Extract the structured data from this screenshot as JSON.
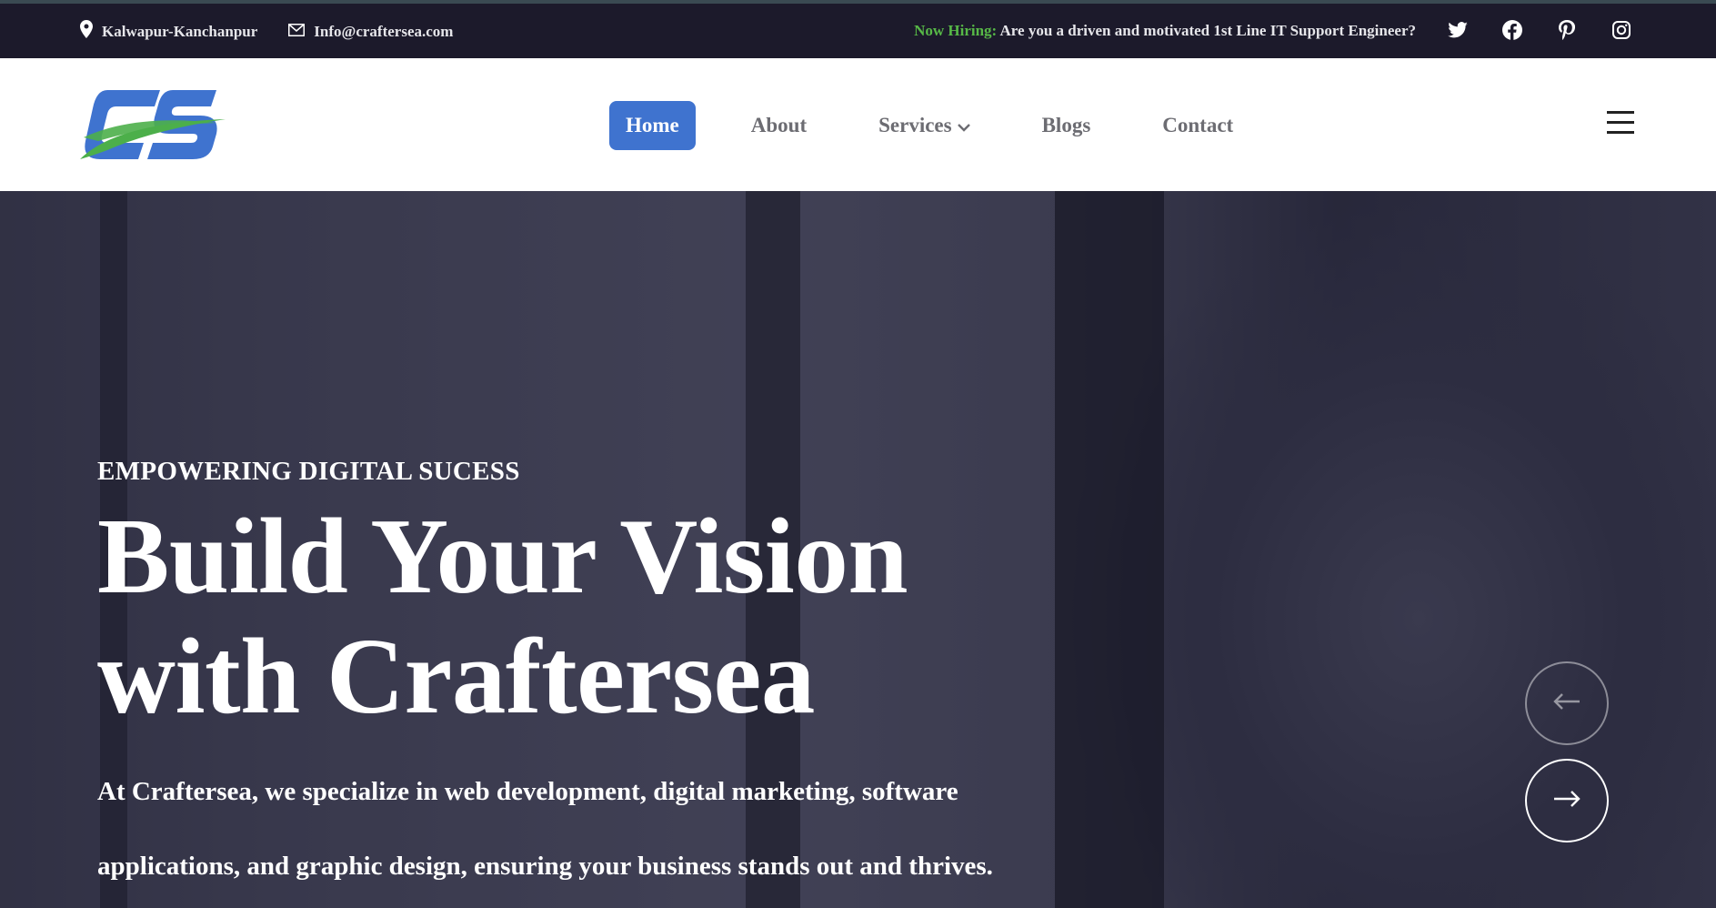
{
  "topbar": {
    "location": "Kalwapur-Kanchanpur",
    "email": "Info@craftersea.com",
    "hiring_tag": "Now Hiring:",
    "hiring_text": "Are you a driven and motivated 1st Line IT Support Engineer?",
    "socials": [
      "twitter-icon",
      "facebook-icon",
      "pinterest-icon",
      "instagram-icon"
    ]
  },
  "header": {
    "logo": "CS",
    "nav": [
      {
        "label": "Home",
        "active": true
      },
      {
        "label": "About"
      },
      {
        "label": "Services",
        "has_dropdown": true
      },
      {
        "label": "Blogs"
      },
      {
        "label": "Contact"
      }
    ]
  },
  "hero": {
    "eyebrow": "EMPOWERING DIGITAL SUCESS",
    "headline_line1": "Build Your Vision",
    "headline_line2": "with Craftersea",
    "description_line1": "At Craftersea, we specialize in web development, digital marketing, software",
    "description_line2": "applications, and graphic design, ensuring your business stands out and thrives."
  },
  "colors": {
    "accent": "#3f73cf",
    "hiring": "#57b847",
    "topbar_bg": "#1c1a2b"
  }
}
